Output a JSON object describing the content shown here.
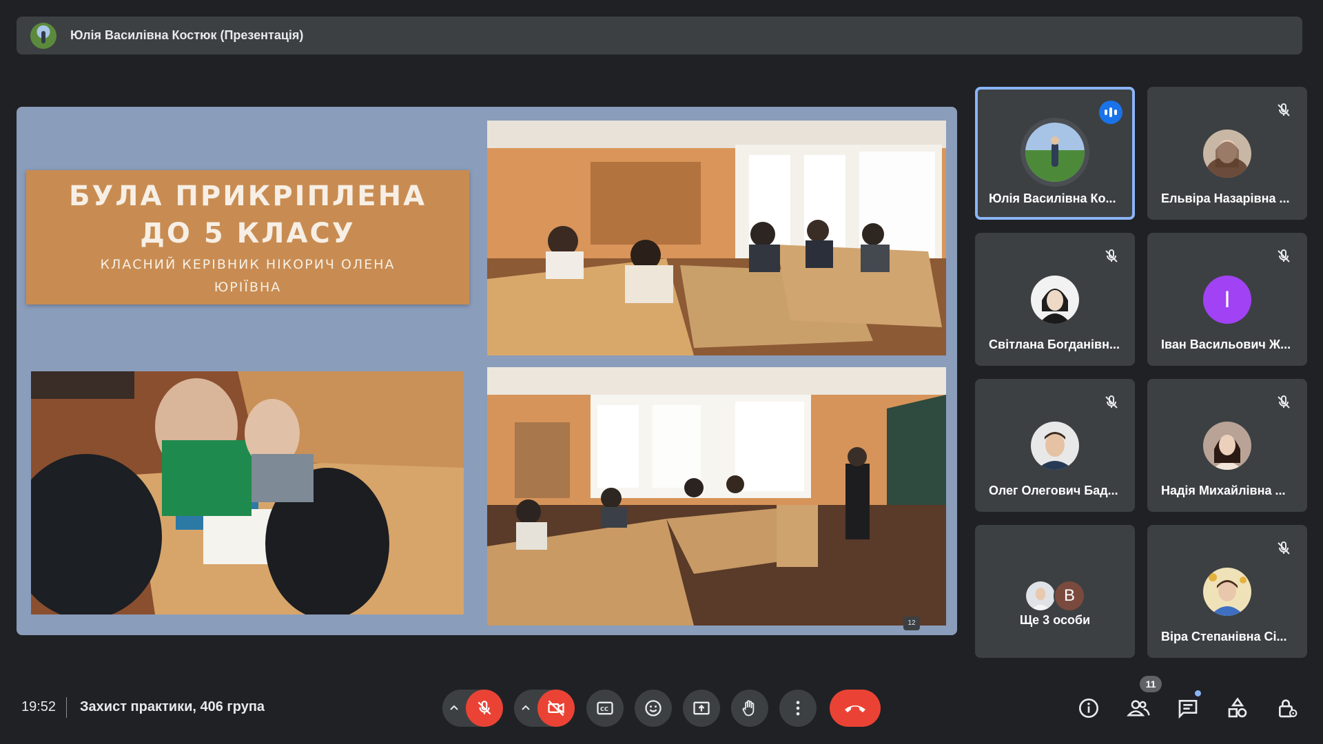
{
  "presenter_bar": {
    "name": "Юлія Василівна Костюк (Презентація)"
  },
  "slide": {
    "title_line1": "БУЛА ПРИКРІПЛЕНА",
    "title_line2": "ДО 5 КЛАСУ",
    "subtitle_line1": "КЛАСНИЙ КЕРІВНИК НІКОРИЧ ОЛЕНА",
    "subtitle_line2": "ЮРІЇВНА",
    "page_number": "12"
  },
  "participants": [
    {
      "name": "Юлія Василівна Ко...",
      "status": "speaking",
      "avatar": "photo"
    },
    {
      "name": "Ельвіра Назарівна ...",
      "status": "muted",
      "avatar": "photo"
    },
    {
      "name": "Світлана Богданівн...",
      "status": "muted",
      "avatar": "photo"
    },
    {
      "name": "Іван Васильович Ж...",
      "status": "muted",
      "avatar": "letter",
      "letter": "І",
      "color": "#a142f4"
    },
    {
      "name": "Олег Олегович Бад...",
      "status": "muted",
      "avatar": "photo"
    },
    {
      "name": "Надія Михайлівна ...",
      "status": "muted",
      "avatar": "photo"
    },
    {
      "name": "Віра Степанівна Сі...",
      "status": "muted",
      "avatar": "photo"
    }
  ],
  "more_participants": {
    "label": "Ще 3 особи",
    "letter": "В"
  },
  "bottom_bar": {
    "time": "19:52",
    "meeting_title": "Захист практики, 406 група",
    "people_count": "11"
  },
  "controls": [
    "mic-off-icon",
    "camera-off-icon",
    "captions-icon",
    "emoji-icon",
    "present-icon",
    "raise-hand-icon",
    "more-options-icon",
    "end-call-icon"
  ],
  "right_controls": [
    "info-icon",
    "people-icon",
    "chat-icon",
    "activities-icon",
    "host-controls-icon"
  ],
  "colors": {
    "accent": "#8ab4f8",
    "danger": "#ea4335",
    "surface": "#3c4043",
    "background": "#202124",
    "slide_bg": "#8a9dbb",
    "title_box": "#c88c52"
  }
}
